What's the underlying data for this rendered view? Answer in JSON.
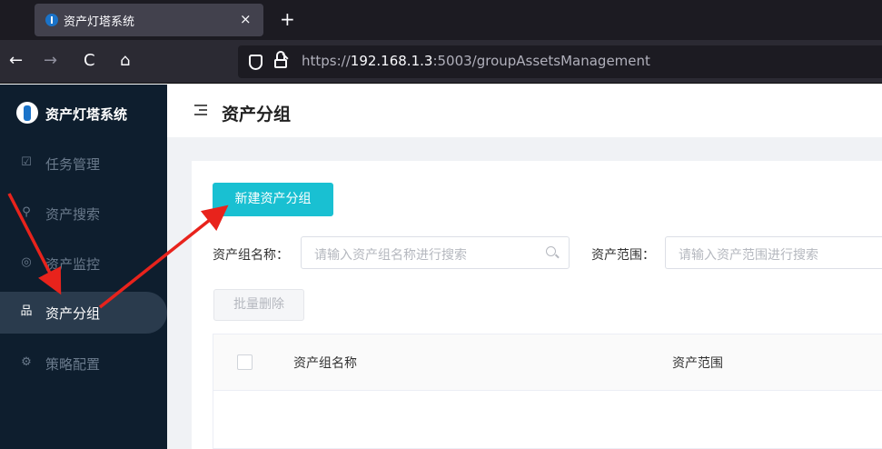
{
  "browser": {
    "tab_title": "资产灯塔系统",
    "tab_close": "×",
    "new_tab": "+",
    "back": "←",
    "forward": "→",
    "reload": "C",
    "home": "⌂",
    "url_scheme": "https://",
    "url_host": "192.168.1.3",
    "url_rest": ":5003/groupAssetsManagement"
  },
  "sidebar": {
    "brand": "资产灯塔系统",
    "items": [
      {
        "label": "任务管理",
        "icon": "task-icon",
        "glyph": "☑"
      },
      {
        "label": "资产搜索",
        "icon": "search-icon",
        "glyph": "⚲"
      },
      {
        "label": "资产监控",
        "icon": "monitor-icon",
        "glyph": "◎"
      },
      {
        "label": "资产分组",
        "icon": "group-icon",
        "glyph": "品",
        "active": true
      },
      {
        "label": "策略配置",
        "icon": "policy-icon",
        "glyph": "⚙"
      }
    ]
  },
  "header": {
    "title": "资产分组"
  },
  "main": {
    "new_group_button": "新建资产分组",
    "group_name_label": "资产组名称：",
    "group_name_placeholder": "请输入资产组名称进行搜索",
    "scope_label": "资产范围：",
    "scope_placeholder": "请输入资产范围进行搜索",
    "batch_delete_button": "批量删除",
    "table": {
      "columns": [
        "资产组名称",
        "资产范围"
      ]
    }
  },
  "colors": {
    "primary": "#19c0d2",
    "sidebar_bg": "#0e1e2e",
    "annotation": "#e8231c"
  }
}
